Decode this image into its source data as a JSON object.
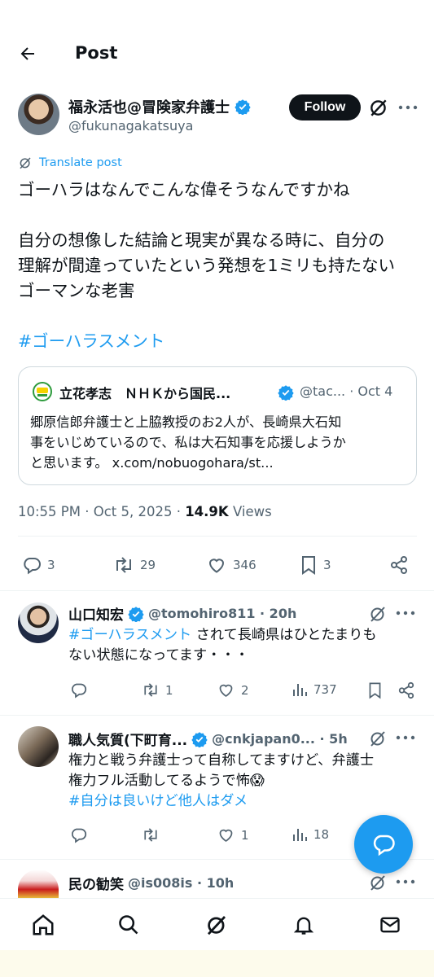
{
  "header": {
    "title": "Post"
  },
  "post": {
    "author_name": "福永活也@冒険家弁護士",
    "author_handle": "@fukunagakatsuya",
    "follow_label": "Follow",
    "translate_label": "Translate post",
    "body_lines": [
      "ゴーハラはなんでこんな偉そうなんですかね",
      "",
      "自分の想像した結論と現実が異なる時に、自分の",
      "理解が間違っていたという発想を1ミリも持たない",
      "ゴーマンな老害"
    ],
    "hashtag": "#ゴーハラスメント",
    "quote": {
      "name": "立花孝志　ＮＨＫから国民...",
      "handle_time": "@tac... · Oct 4",
      "lines": [
        "郷原信郎弁護士と上脇教授のお2人が、長崎県大石知",
        "事をいじめているので、私は大石知事を応援しようか",
        "と思います。 x.com/nobuogohara/st..."
      ]
    },
    "time": "10:55 PM · Oct 5, 2025 · ",
    "views_count": "14.9K",
    "views_label": " Views",
    "stats": {
      "replies": "3",
      "reposts": "29",
      "likes": "346",
      "bookmarks": "3"
    }
  },
  "replies": [
    {
      "name": "山口知宏",
      "meta": "@tomohiro811 · 20h",
      "hashtag": "#ゴーハラスメント",
      "line1_rest": " されて長崎県はひとたまりも",
      "line2": "ない状態になってます・・・",
      "stats": {
        "replies": "",
        "reposts": "1",
        "likes": "2",
        "views": "737"
      }
    },
    {
      "name": "職人気質(下町育...",
      "meta": "@cnkjapan0... · 5h",
      "line1": "権力と戦う弁護士って自称してますけど、弁護士",
      "line2": "権力フル活動してるようで怖😱",
      "hashtag": "#自分は良いけど他人はダメ",
      "stats": {
        "replies": "",
        "reposts": "",
        "likes": "1",
        "views": "18"
      }
    },
    {
      "name": "民の勧笑",
      "meta": "@is008is · 10h"
    }
  ],
  "colors": {
    "accent": "#1d9bf0",
    "text": "#0f1419",
    "secondary": "#536471",
    "verified": "#1d9bf0"
  }
}
